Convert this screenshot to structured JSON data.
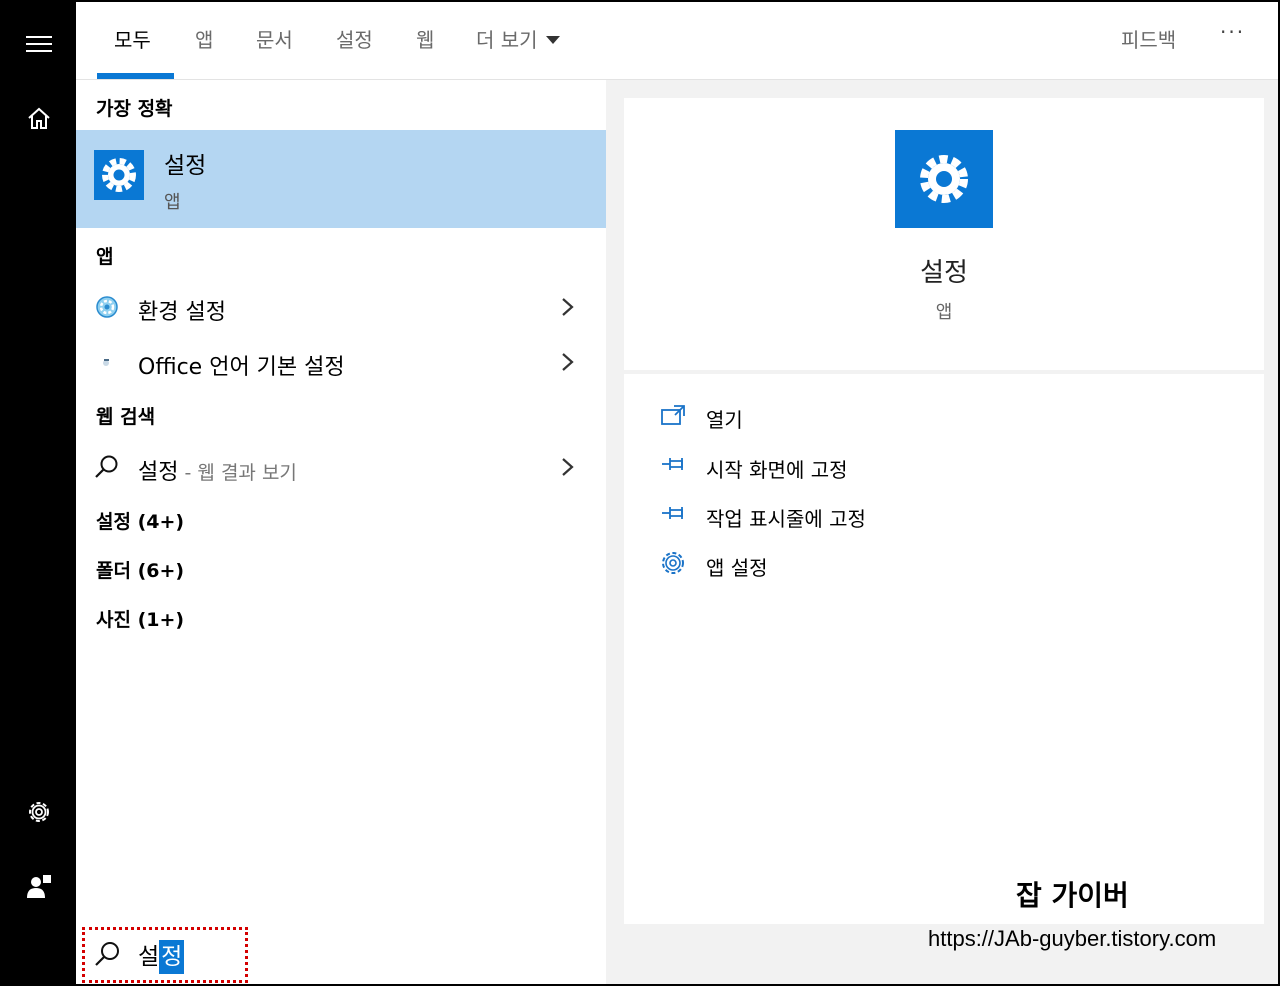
{
  "tabs": [
    "모두",
    "앱",
    "문서",
    "설정",
    "웹",
    "더 보기"
  ],
  "header_right": {
    "feedback": "피드백",
    "more": "···"
  },
  "best_match": {
    "heading": "가장 정확",
    "title": "설정",
    "subtitle": "앱"
  },
  "apps": {
    "heading": "앱",
    "items": [
      {
        "label": "환경 설정",
        "icon": "control-panel-icon"
      },
      {
        "label": "Office 언어 기본 설정",
        "icon": "office-language-icon"
      }
    ]
  },
  "web": {
    "heading": "웹 검색",
    "query": "설정",
    "suffix": " - 웹 결과 보기"
  },
  "categories": [
    "설정 (4+)",
    "폴더 (6+)",
    "사진 (1+)"
  ],
  "detail": {
    "title": "설정",
    "subtitle": "앱",
    "actions": [
      {
        "label": "열기",
        "icon": "open-icon"
      },
      {
        "label": "시작 화면에 고정",
        "icon": "pin-icon"
      },
      {
        "label": "작업 표시줄에 고정",
        "icon": "pin-icon"
      },
      {
        "label": "앱 설정",
        "icon": "gear-icon"
      }
    ]
  },
  "search": {
    "text_plain": "설",
    "text_selected": "정"
  },
  "watermark": {
    "title": "잡 가이버",
    "url": "https://JAb-guyber.tistory.com"
  },
  "colors": {
    "accent": "#0a78d4",
    "highlight": "#b4d6f2",
    "rail": "#000000",
    "dashed_box": "#d40000"
  }
}
